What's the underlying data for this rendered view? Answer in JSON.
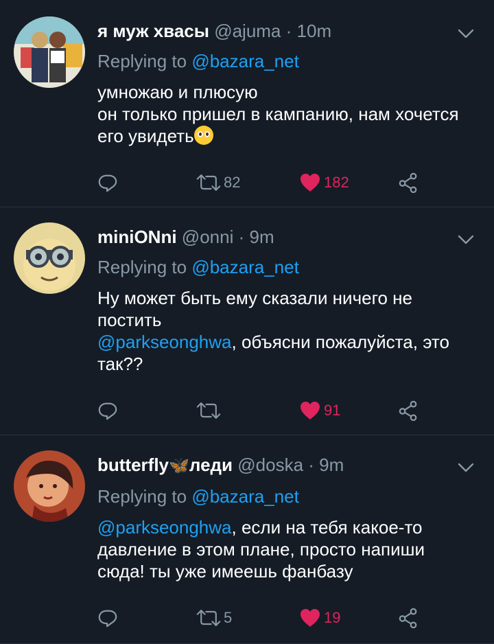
{
  "tweets": [
    {
      "name": "я муж хвасы",
      "handle": "@ajuma",
      "time": "10m",
      "replying_prefix": "Replying to",
      "replying_to": "@bazara_net",
      "body_lines": [
        "умножаю и плюсую",
        "он только пришел в кампанию, нам хочется его увидеть"
      ],
      "retweets": "82",
      "likes": "182",
      "avatar_colors": [
        "#6fb3a8",
        "#c9a66b",
        "#2e3a55"
      ]
    },
    {
      "name": "miniONni",
      "handle": "@onni",
      "time": "9m",
      "replying_prefix": "Replying to",
      "replying_to": "@bazara_net",
      "body_line1": "Ну может быть ему сказали ничего не постить",
      "mention": "@parkseonghwa",
      "body_line2": ", объясни пожалуйста, это так??",
      "retweets": "",
      "likes": "91",
      "avatar_colors": [
        "#e8d79a",
        "#b8c6c4",
        "#2b3140"
      ]
    },
    {
      "name_part1": "butterfly",
      "name_part2": "леди",
      "butterfly_glyph": "🦋",
      "handle": "@doska",
      "time": "9m",
      "replying_prefix": "Replying to",
      "replying_to": "@bazara_net",
      "mention": "@parkseonghwa",
      "body_rest": ", если на тебя какое-то давление в этом плане, просто напиши сюда! ты уже имеешь фанбазу",
      "retweets": "5",
      "likes": "19",
      "avatar_colors": [
        "#b34a2e",
        "#e8a57a",
        "#3a1c18"
      ]
    }
  ],
  "icons": {
    "reply": "reply-icon",
    "retweet": "retweet-icon",
    "like": "heart-icon",
    "share": "share-icon",
    "menu": "chevron-down-icon"
  },
  "colors": {
    "background": "#151c26",
    "link": "#1da1f2",
    "muted": "#8899a6",
    "like": "#e0245e"
  }
}
